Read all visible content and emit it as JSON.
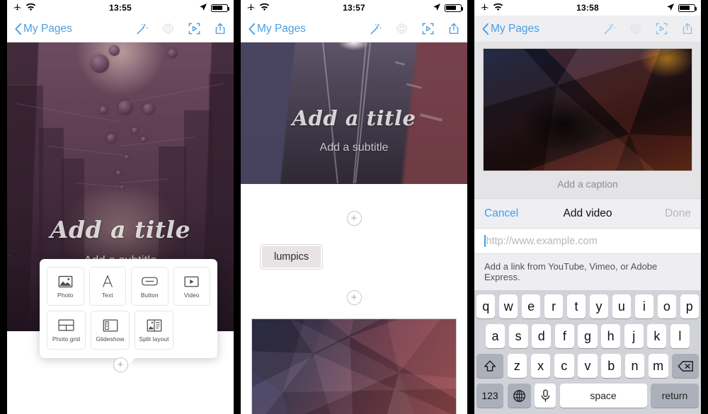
{
  "phones": [
    {
      "id": "phone1",
      "status": {
        "time": "13:55",
        "airplane_icon": "airplane-icon",
        "wifi_icon": "wifi-icon",
        "location_icon": "location-arrow-icon",
        "battery_icon": "battery-icon"
      },
      "nav": {
        "back_label": "My Pages",
        "icons": [
          "magic-wand-icon",
          "gear-icon",
          "preview-icon",
          "share-icon"
        ]
      },
      "hero": {
        "title": "Add a title",
        "subtitle": "Add a subtitle"
      },
      "insert_panel": {
        "row1": [
          {
            "label": "Photo",
            "icon": "photo-icon"
          },
          {
            "label": "Text",
            "icon": "text-icon"
          },
          {
            "label": "Button",
            "icon": "button-icon"
          },
          {
            "label": "Video",
            "icon": "video-icon"
          }
        ],
        "row2": [
          {
            "label": "Photo grid",
            "icon": "photo-grid-icon"
          },
          {
            "label": "Glideshow",
            "icon": "glideshow-icon"
          },
          {
            "label": "Split layout",
            "icon": "split-layout-icon"
          }
        ]
      },
      "add_button_label": "+"
    },
    {
      "id": "phone2",
      "status": {
        "time": "13:57"
      },
      "nav": {
        "back_label": "My Pages"
      },
      "hero": {
        "title": "Add a title",
        "subtitle": "Add a subtitle"
      },
      "body": {
        "button_label": "lumpics",
        "plus_label": "+"
      }
    },
    {
      "id": "phone3",
      "status": {
        "time": "13:58"
      },
      "nav": {
        "back_label": "My Pages"
      },
      "caption": "Add a caption",
      "dialog": {
        "cancel": "Cancel",
        "title": "Add video",
        "done": "Done",
        "input_placeholder": "http://www.example.com",
        "input_value": "",
        "hint": "Add a link from YouTube, Vimeo, or Adobe Express."
      },
      "keyboard": {
        "row1": [
          "q",
          "w",
          "e",
          "r",
          "t",
          "y",
          "u",
          "i",
          "o",
          "p"
        ],
        "row2": [
          "a",
          "s",
          "d",
          "f",
          "g",
          "h",
          "j",
          "k",
          "l"
        ],
        "row3": [
          "z",
          "x",
          "c",
          "v",
          "b",
          "n",
          "m"
        ],
        "shift_icon": "shift-icon",
        "backspace_icon": "backspace-icon",
        "numbers_label": "123",
        "globe_icon": "globe-icon",
        "mic_icon": "microphone-icon",
        "space_label": "space",
        "return_label": "return"
      }
    }
  ],
  "colors": {
    "accent_blue": "#4a9fe0",
    "link_blue": "#3aa0f0",
    "disabled_gray": "#b6b6bb",
    "keyboard_bg": "#d1d3d9"
  }
}
